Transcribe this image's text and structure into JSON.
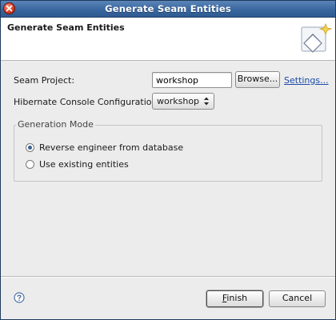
{
  "window": {
    "title": "Generate Seam Entities"
  },
  "header": {
    "title": "Generate Seam Entities",
    "icon": "seam-wizard-icon"
  },
  "form": {
    "seam_project_label": "Seam Project:",
    "seam_project_value": "workshop",
    "browse_label": "Browse...",
    "settings_label": "Settings...",
    "console_config_label": "Hibernate Console Configuration:",
    "console_config_value": "workshop"
  },
  "generation_mode": {
    "legend": "Generation Mode",
    "options": [
      {
        "label": "Reverse engineer from database",
        "selected": true
      },
      {
        "label": "Use existing entities",
        "selected": false
      }
    ]
  },
  "footer": {
    "help_icon": "help-icon",
    "finish_label": "Finish",
    "finish_mnemonic": "F",
    "finish_rest": "inish",
    "cancel_label": "Cancel"
  },
  "colors": {
    "titlebar": "#3a67a0",
    "dialog_bg": "#ececec",
    "link": "#1a4aa8",
    "radio_selected": "#3d5f92"
  }
}
